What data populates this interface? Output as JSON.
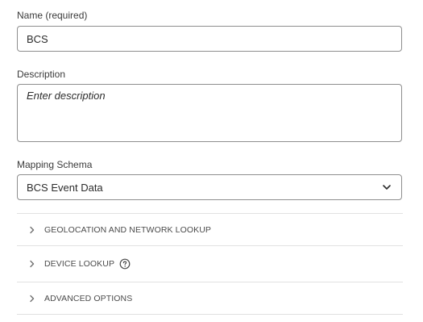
{
  "form": {
    "name_label": "Name (required)",
    "name_value": "BCS",
    "description_label": "Description",
    "description_placeholder": "Enter description",
    "mapping_schema_label": "Mapping Schema",
    "mapping_schema_value": "BCS Event Data"
  },
  "sections": [
    {
      "label": "GEOLOCATION AND NETWORK LOOKUP",
      "icon": "chevron-right-icon"
    },
    {
      "label": "DEVICE LOOKUP",
      "icon": "chevron-right-icon",
      "help_icon": "help-icon"
    },
    {
      "label": "ADVANCED OPTIONS",
      "icon": "chevron-right-icon"
    }
  ],
  "colors": {
    "border": "#8e8e8e",
    "divider": "#e1e1e1",
    "text": "#2c2c2c"
  }
}
